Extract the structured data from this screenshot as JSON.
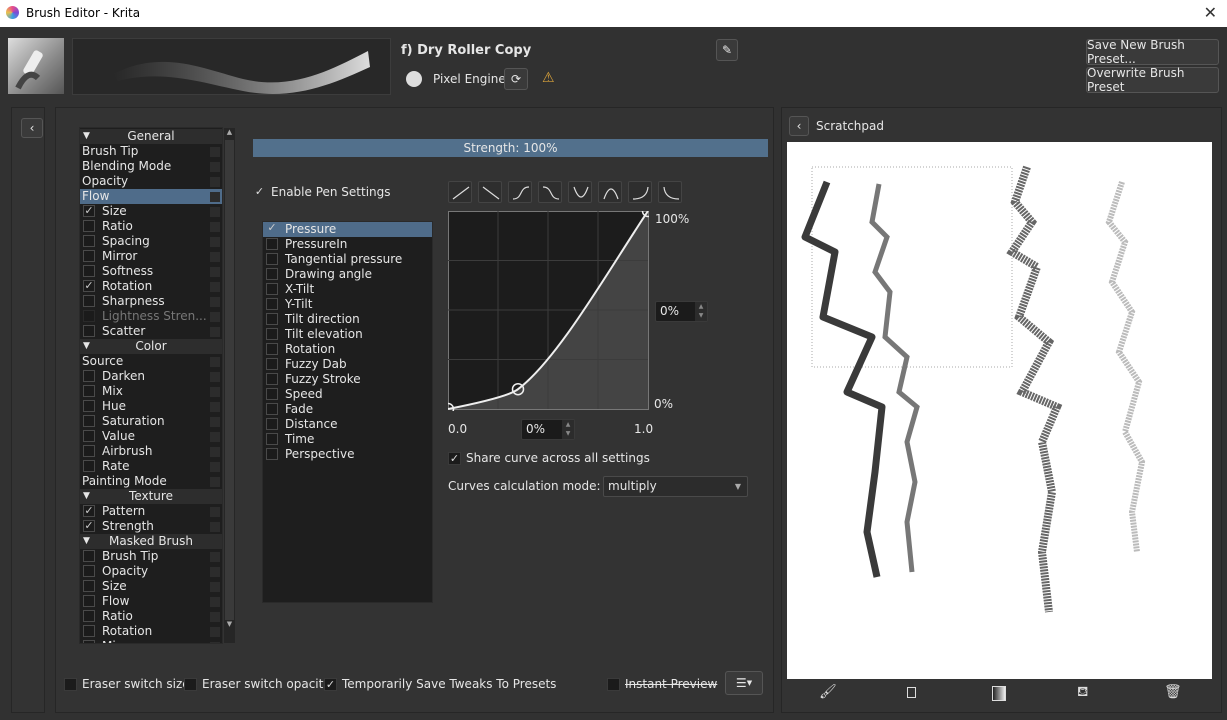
{
  "window": {
    "title": "Brush Editor - Krita",
    "close": "✕"
  },
  "header": {
    "preset_name": "f) Dry Roller Copy",
    "engine": "Pixel Engine",
    "save_new": "Save New Brush Preset...",
    "overwrite": "Overwrite Brush Preset",
    "warning": "⚠"
  },
  "options": [
    {
      "type": "hdr",
      "label": "General"
    },
    {
      "type": "plain",
      "label": "Brush Tip"
    },
    {
      "type": "plain",
      "label": "Blending Mode"
    },
    {
      "type": "plain",
      "label": "Opacity"
    },
    {
      "type": "plain",
      "label": "Flow",
      "selected": true
    },
    {
      "type": "cb",
      "label": "Size",
      "checked": true
    },
    {
      "type": "cb",
      "label": "Ratio"
    },
    {
      "type": "cb",
      "label": "Spacing"
    },
    {
      "type": "cb",
      "label": "Mirror"
    },
    {
      "type": "cb",
      "label": "Softness"
    },
    {
      "type": "cb",
      "label": "Rotation",
      "checked": true
    },
    {
      "type": "cb",
      "label": "Sharpness"
    },
    {
      "type": "cb",
      "label": "Lightness Stren...",
      "disabled": true
    },
    {
      "type": "cb",
      "label": "Scatter"
    },
    {
      "type": "hdr",
      "label": "Color"
    },
    {
      "type": "plain",
      "label": "Source"
    },
    {
      "type": "cb",
      "label": "Darken"
    },
    {
      "type": "cb",
      "label": "Mix"
    },
    {
      "type": "cb",
      "label": "Hue"
    },
    {
      "type": "cb",
      "label": "Saturation"
    },
    {
      "type": "cb",
      "label": "Value"
    },
    {
      "type": "cb",
      "label": "Airbrush"
    },
    {
      "type": "cb",
      "label": "Rate"
    },
    {
      "type": "plain",
      "label": "Painting Mode"
    },
    {
      "type": "hdr",
      "label": "Texture"
    },
    {
      "type": "cb",
      "label": "Pattern",
      "checked": true
    },
    {
      "type": "cb",
      "label": "Strength",
      "checked": true
    },
    {
      "type": "hdr",
      "label": "Masked Brush"
    },
    {
      "type": "cb",
      "label": "Brush Tip"
    },
    {
      "type": "cb",
      "label": "Opacity"
    },
    {
      "type": "cb",
      "label": "Size"
    },
    {
      "type": "cb",
      "label": "Flow"
    },
    {
      "type": "cb",
      "label": "Ratio"
    },
    {
      "type": "cb",
      "label": "Rotation"
    },
    {
      "type": "cb",
      "label": "Mi..."
    }
  ],
  "strength": {
    "label": "Strength: 100%",
    "value": 100
  },
  "pen": {
    "enable_label": "Enable Pen Settings",
    "enabled": true
  },
  "sensors": [
    {
      "label": "Pressure",
      "checked": true,
      "selected": true
    },
    {
      "label": "PressureIn"
    },
    {
      "label": "Tangential pressure"
    },
    {
      "label": "Drawing angle"
    },
    {
      "label": "X-Tilt"
    },
    {
      "label": "Y-Tilt"
    },
    {
      "label": "Tilt direction"
    },
    {
      "label": "Tilt elevation"
    },
    {
      "label": "Rotation"
    },
    {
      "label": "Fuzzy Dab"
    },
    {
      "label": "Fuzzy Stroke"
    },
    {
      "label": "Speed"
    },
    {
      "label": "Fade"
    },
    {
      "label": "Distance"
    },
    {
      "label": "Time"
    },
    {
      "label": "Perspective"
    }
  ],
  "curve": {
    "y_max": "100%",
    "y_min": "0%",
    "y_spin": "0%",
    "x_min": "0.0",
    "x_spin": "0%",
    "x_max": "1.0",
    "points": [
      [
        0,
        0
      ],
      [
        0.35,
        0.1
      ],
      [
        1,
        1
      ]
    ],
    "share_label": "Share curve across all settings",
    "share": true,
    "mode_label": "Curves calculation mode:",
    "mode": "multiply"
  },
  "bottom": {
    "eraser_size": "Eraser switch size",
    "eraser_opacity": "Eraser switch opacity",
    "temp_save": "Temporarily Save Tweaks To Presets",
    "instant_preview": "Instant Preview"
  },
  "scratchpad": {
    "title": "Scratchpad"
  }
}
